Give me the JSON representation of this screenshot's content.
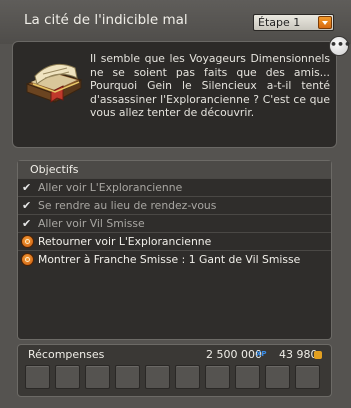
{
  "window": {
    "title": "La cité de l'indicible mal",
    "step_select": {
      "value": "Étape 1",
      "accent": "#e87a1a"
    }
  },
  "description": {
    "icon": "book-scroll-icon",
    "text": "Il semble que les Voyageurs Dimensionnels ne se soient pas faits que des amis... Pourquoi Gein le Silencieux a-t-il tenté d'assassiner l'Explorancienne ? C'est ce que vous allez tenter de découvrir.",
    "more_button": "•••"
  },
  "objectives": {
    "header": "Objectifs",
    "items": [
      {
        "label": "Aller voir L'Explorancienne",
        "status": "done",
        "icon": "check-icon"
      },
      {
        "label": "Se rendre au lieu de rendez-vous",
        "status": "done",
        "icon": "check-icon"
      },
      {
        "label": "Aller voir Vil Smisse",
        "status": "done",
        "icon": "check-icon"
      },
      {
        "label": "Retourner voir L'Explorancienne",
        "status": "todo",
        "icon": "quest-target-icon"
      },
      {
        "label": "Montrer à Franche Smisse : 1 Gant de Vil Smisse",
        "status": "todo",
        "icon": "quest-target-icon"
      }
    ]
  },
  "rewards": {
    "label": "Récompenses",
    "xp": "2 500 000",
    "xp_icon_text": "XP",
    "kamas": "43 980",
    "slot_count": 10
  }
}
